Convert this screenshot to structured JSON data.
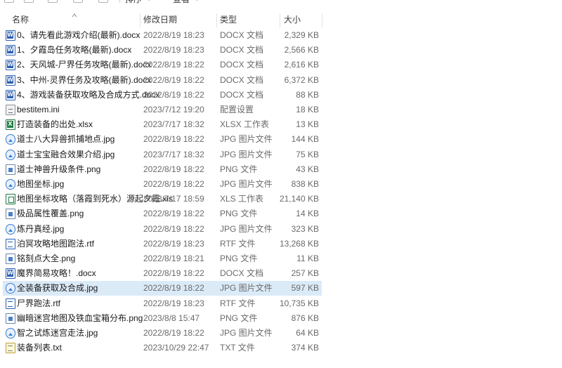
{
  "toolbar": {
    "sort_label": "排序",
    "view_label": "查看",
    "more_label": "···"
  },
  "columns": {
    "name": "名称",
    "date": "修改日期",
    "type": "类型",
    "size": "大小"
  },
  "files": [
    {
      "name": "0、请先看此游戏介绍(最新).docx",
      "date": "2022/8/19 18:23",
      "type": "DOCX 文档",
      "size": "2,329 KB",
      "icon": "docx"
    },
    {
      "name": "1、夕霞岛任务攻略(最新).docx",
      "date": "2022/8/19 18:23",
      "type": "DOCX 文档",
      "size": "2,566 KB",
      "icon": "docx"
    },
    {
      "name": "2、天风城-尸界任务攻略(最新).docx",
      "date": "2022/8/19 18:22",
      "type": "DOCX 文档",
      "size": "2,616 KB",
      "icon": "docx"
    },
    {
      "name": "3、中州-灵界任务及攻略(最新).docx",
      "date": "2022/8/19 18:22",
      "type": "DOCX 文档",
      "size": "6,372 KB",
      "icon": "docx"
    },
    {
      "name": "4、游戏装备获取攻略及合成方式.docx",
      "date": "2022/8/19 18:22",
      "type": "DOCX 文档",
      "size": "88 KB",
      "icon": "docx"
    },
    {
      "name": "bestitem.ini",
      "date": "2023/7/12 19:20",
      "type": "配置设置",
      "size": "18 KB",
      "icon": "ini"
    },
    {
      "name": "打造装备的出处.xlsx",
      "date": "2023/7/17 18:32",
      "type": "XLSX 工作表",
      "size": "13 KB",
      "icon": "xlsx"
    },
    {
      "name": "道士八大异兽抓捕地点.jpg",
      "date": "2022/8/19 18:22",
      "type": "JPG 图片文件",
      "size": "144 KB",
      "icon": "jpg"
    },
    {
      "name": "道士宝宝融合效果介绍.jpg",
      "date": "2023/7/17 18:32",
      "type": "JPG 图片文件",
      "size": "75 KB",
      "icon": "jpg"
    },
    {
      "name": "道士神兽升级条件.png",
      "date": "2022/8/19 18:22",
      "type": "PNG 文件",
      "size": "43 KB",
      "icon": "png"
    },
    {
      "name": "地图坐标.jpg",
      "date": "2022/8/19 18:22",
      "type": "JPG 图片文件",
      "size": "838 KB",
      "icon": "jpg"
    },
    {
      "name": "地图坐标攻略（落霞到死水）源起夕霞.xls",
      "date": "2023/7/17 18:59",
      "type": "XLS 工作表",
      "size": "21,140 KB",
      "icon": "xls"
    },
    {
      "name": "极品属性覆盖.png",
      "date": "2022/8/19 18:22",
      "type": "PNG 文件",
      "size": "14 KB",
      "icon": "png"
    },
    {
      "name": "炼丹真经.jpg",
      "date": "2022/8/19 18:22",
      "type": "JPG 图片文件",
      "size": "323 KB",
      "icon": "jpg"
    },
    {
      "name": "泊冥攻略地图跑法.rtf",
      "date": "2022/8/19 18:23",
      "type": "RTF 文件",
      "size": "13,268 KB",
      "icon": "rtf"
    },
    {
      "name": "铭刻点大全.png",
      "date": "2022/8/19 18:21",
      "type": "PNG 文件",
      "size": "11 KB",
      "icon": "png"
    },
    {
      "name": "魔界简易攻略！.docx",
      "date": "2022/8/19 18:22",
      "type": "DOCX 文档",
      "size": "257 KB",
      "icon": "docx"
    },
    {
      "name": "全装备获取及合成.jpg",
      "date": "2022/8/19 18:22",
      "type": "JPG 图片文件",
      "size": "597 KB",
      "icon": "jpg",
      "selected": true
    },
    {
      "name": "尸界跑法.rtf",
      "date": "2022/8/19 18:23",
      "type": "RTF 文件",
      "size": "10,735 KB",
      "icon": "rtf"
    },
    {
      "name": "幽暗迷宫地图及铁血宝箱分布.png",
      "date": "2023/8/8 15:47",
      "type": "PNG 文件",
      "size": "876 KB",
      "icon": "png"
    },
    {
      "name": "智之试炼迷宫走法.jpg",
      "date": "2022/8/19 18:22",
      "type": "JPG 图片文件",
      "size": "64 KB",
      "icon": "jpg"
    },
    {
      "name": "装备列表.txt",
      "date": "2023/10/29 22:47",
      "type": "TXT 文件",
      "size": "374 KB",
      "icon": "txt"
    }
  ],
  "colors": {
    "selected_row": "#dbeaf7",
    "header_text": "#3a3a3a",
    "meta_text": "#6a6a6a"
  }
}
